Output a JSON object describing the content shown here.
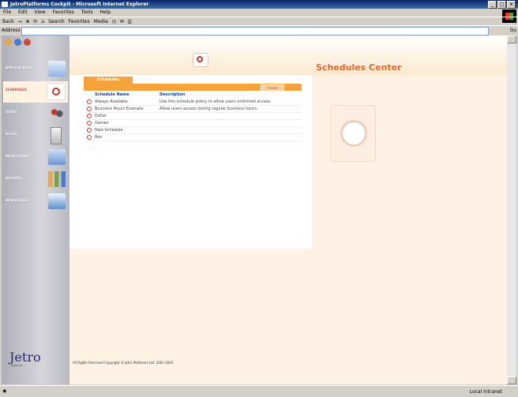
{
  "window": {
    "title": "JetroPlatforms Cockpit - Microsoft Internet Explorer"
  },
  "menu": [
    "File",
    "Edit",
    "View",
    "Favorites",
    "Tools",
    "Help"
  ],
  "toolbar": {
    "back": "Back",
    "search": "Search",
    "favorites": "Favorites",
    "media": "Media"
  },
  "address": {
    "label": "Address",
    "go": "Go"
  },
  "sidebar": {
    "items": [
      {
        "label": "APPLICATIONS",
        "icon": "applications-icon"
      },
      {
        "label": "SCHEDULES",
        "icon": "clock-icon",
        "active": true
      },
      {
        "label": "USERS",
        "icon": "users-icon"
      },
      {
        "label": "RULES",
        "icon": "trash-icon"
      },
      {
        "label": "MONITORING",
        "icon": "monitor-icon"
      },
      {
        "label": "REPORTS",
        "icon": "bar-chart-icon"
      },
      {
        "label": "WEB ACCESS",
        "icon": "web-icon"
      }
    ],
    "brand": "Jetro",
    "brand_sub": "platforms"
  },
  "page": {
    "title": "Schedules Center",
    "tab": "Schedules",
    "create": "Create",
    "columns": {
      "name": "Schedule Name",
      "description": "Description"
    },
    "rows": [
      {
        "name": "Always Available",
        "description": "Use this schedule policy to allow users unlimited access."
      },
      {
        "name": "Business Hours Example",
        "description": "Allow users access during regular business hours."
      },
      {
        "name": "Dollar",
        "description": ""
      },
      {
        "name": "Games",
        "description": ""
      },
      {
        "name": "New Schedule",
        "description": ""
      },
      {
        "name": "Ron",
        "description": ""
      }
    ],
    "footer": "All Rights Reserved Copyright © Jetro Platforms Ltd. 2001-2003"
  },
  "status": {
    "zone": "Local intranet"
  },
  "colors": {
    "accent": "#f7a33b",
    "title": "#e2682a",
    "link": "#1d3e8c"
  }
}
